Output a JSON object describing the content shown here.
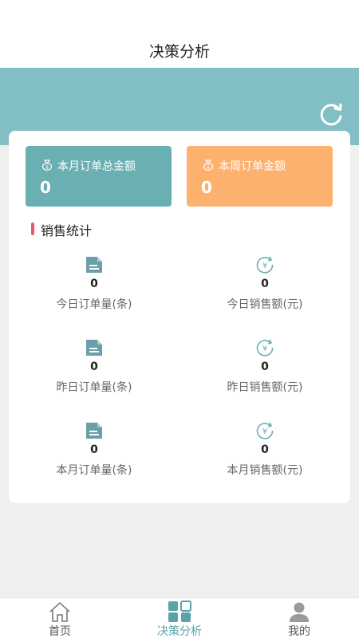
{
  "header": {
    "title": "决策分析"
  },
  "summary": {
    "month_label": "本月订单总金额",
    "month_value": "0",
    "week_label": "本周订单金额",
    "week_value": "0"
  },
  "section": {
    "title": "销售统计"
  },
  "stats": [
    {
      "value": "0",
      "label": "今日订单量(条)",
      "icon": "document-icon"
    },
    {
      "value": "0",
      "label": "今日销售额(元)",
      "icon": "yen-refresh-icon"
    },
    {
      "value": "0",
      "label": "昨日订单量(条)",
      "icon": "document-icon"
    },
    {
      "value": "0",
      "label": "昨日销售额(元)",
      "icon": "yen-refresh-icon"
    },
    {
      "value": "0",
      "label": "本月订单量(条)",
      "icon": "document-icon"
    },
    {
      "value": "0",
      "label": "本月销售额(元)",
      "icon": "yen-refresh-icon"
    }
  ],
  "tabbar": {
    "home": "首页",
    "analysis": "决策分析",
    "mine": "我的"
  },
  "colors": {
    "teal": "#81bfc4",
    "month_card": "#6aafb1",
    "week_card": "#fdb16f",
    "accent_bar": "#e85a6a",
    "active_tab": "#5aa3a8"
  }
}
